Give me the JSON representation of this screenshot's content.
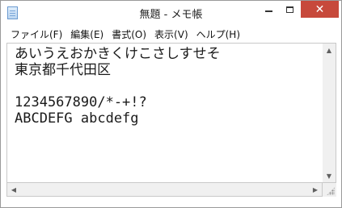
{
  "window": {
    "title": "無題 - メモ帳",
    "close_glyph": "✕"
  },
  "menu": {
    "items": [
      {
        "label": "ファイル(F)"
      },
      {
        "label": "編集(E)"
      },
      {
        "label": "書式(O)"
      },
      {
        "label": "表示(V)"
      },
      {
        "label": "ヘルプ(H)"
      }
    ]
  },
  "editor": {
    "content": "あいうえおかきくけこさしすせそ\n東京都千代田区\n\n1234567890/*-+!?\nABCDEFG abcdefg"
  },
  "scrollbars": {
    "up_glyph": "▲",
    "down_glyph": "▼",
    "left_glyph": "◀",
    "right_glyph": "▶"
  },
  "colors": {
    "close_button": "#c7493b",
    "editor_background": "#ffffff",
    "text": "#1a1a1a"
  },
  "icons": [
    "notepad-app-icon",
    "minimize-icon",
    "maximize-icon",
    "close-icon",
    "scroll-up-icon",
    "scroll-down-icon",
    "scroll-left-icon",
    "scroll-right-icon",
    "resize-grip-icon"
  ]
}
